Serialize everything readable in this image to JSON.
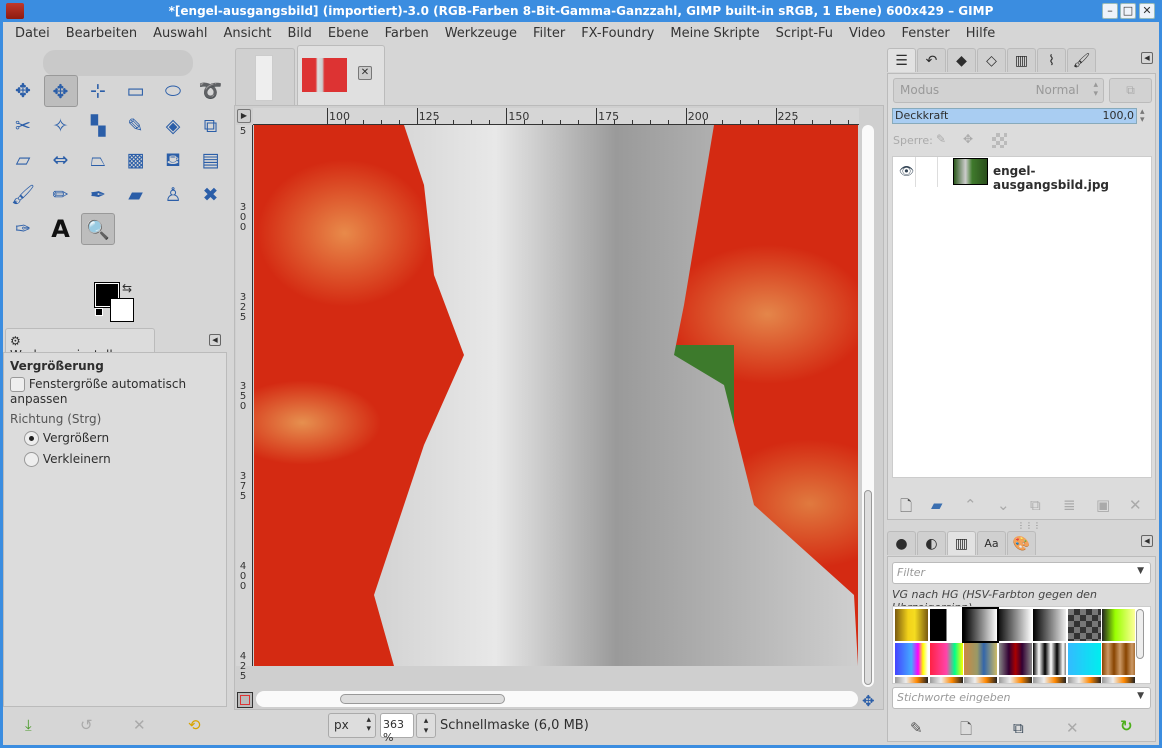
{
  "window": {
    "title": "*[engel-ausgangsbild] (importiert)-3.0 (RGB-Farben 8-Bit-Gamma-Ganzzahl, GIMP built-in sRGB, 1 Ebene) 600x429 – GIMP",
    "min": "–",
    "max": "□",
    "close": "✕"
  },
  "menu": [
    "Datei",
    "Bearbeiten",
    "Auswahl",
    "Ansicht",
    "Bild",
    "Ebene",
    "Farben",
    "Werkzeuge",
    "Filter",
    "FX-Foundry",
    "Meine Skripte",
    "Script-Fu",
    "Video",
    "Fenster",
    "Hilfe"
  ],
  "tools": [
    {
      "name": "alignment-icon",
      "g": "✥"
    },
    {
      "name": "move-icon",
      "g": "✥",
      "sel": true
    },
    {
      "name": "crop-icon",
      "g": "⊹"
    },
    {
      "name": "rect-select-icon",
      "g": "▭"
    },
    {
      "name": "ellipse-select-icon",
      "g": "⬭"
    },
    {
      "name": "free-select-icon",
      "g": "➰"
    },
    {
      "name": "scissors-select-icon",
      "g": "✂"
    },
    {
      "name": "fuzzy-select-icon",
      "g": "✧"
    },
    {
      "name": "color-select-icon",
      "g": "▚"
    },
    {
      "name": "foreground-select-icon",
      "g": "✎"
    },
    {
      "name": "unified-transform-icon",
      "g": "◈"
    },
    {
      "name": "scale-icon",
      "g": "⧉"
    },
    {
      "name": "shear-icon",
      "g": "▱"
    },
    {
      "name": "flip-icon",
      "g": "⇔"
    },
    {
      "name": "perspective-icon",
      "g": "⏢"
    },
    {
      "name": "warp-icon",
      "g": "▩"
    },
    {
      "name": "bucket-fill-icon",
      "g": "⛾"
    },
    {
      "name": "blend-icon",
      "g": "▤"
    },
    {
      "name": "paintbrush-icon",
      "g": "🖌"
    },
    {
      "name": "pencil-icon",
      "g": "✏"
    },
    {
      "name": "airbrush-icon",
      "g": "✒"
    },
    {
      "name": "eraser-icon",
      "g": "▰"
    },
    {
      "name": "clone-icon",
      "g": "♙"
    },
    {
      "name": "heal-icon",
      "g": "✖"
    },
    {
      "name": "paths-icon",
      "g": "✑"
    },
    {
      "name": "text-icon",
      "g": "A"
    },
    {
      "name": "zoom-icon",
      "g": "🔍",
      "sel": true
    }
  ],
  "tool_options": {
    "tab": "Werkzeugeinstellungen",
    "title": "Vergrößerung",
    "auto_resize": "Fenstergröße automatisch anpassen",
    "direction_label": "Richtung (Strg)",
    "zoom_in": "Vergrößern",
    "zoom_out": "Verkleinern"
  },
  "ruler": {
    "h": [
      "100",
      "125",
      "150",
      "175",
      "200",
      "225"
    ],
    "v": [
      "5",
      "300",
      "325",
      "350",
      "375",
      "400",
      "425"
    ]
  },
  "status": {
    "unit": "px",
    "zoom": "363 %",
    "message": "Schnellmaske (6,0 MB)"
  },
  "layers": {
    "mode_label": "Modus",
    "mode_value": "Normal",
    "opacity_label": "Deckkraft",
    "opacity_value": "100,0",
    "lock_label": "Sperre:",
    "items": [
      {
        "name": "engel-ausgangsbild.jpg"
      }
    ]
  },
  "gradients": {
    "filter_placeholder": "Filter",
    "current": "VG nach HG (HSV-Farbton gegen den Uhrzeigersinn)",
    "tags_placeholder": "Stichworte eingeben"
  },
  "colors": {
    "accent": "#3b8de0",
    "selection": "#a9cdf2"
  }
}
